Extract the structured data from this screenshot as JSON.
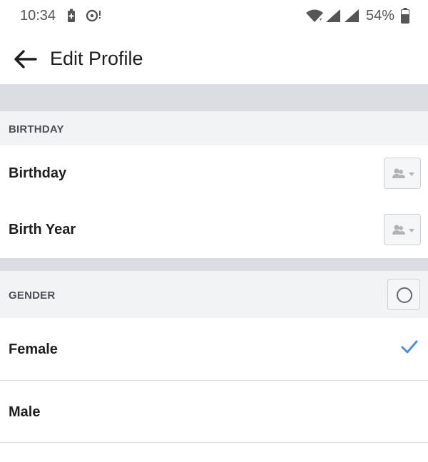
{
  "status_bar": {
    "time": "10:34",
    "battery_percent": "54%"
  },
  "app_bar": {
    "title": "Edit Profile"
  },
  "birthday_section": {
    "header": "BIRTHDAY",
    "rows": [
      {
        "label": "Birthday",
        "value": "",
        "privacy_icon": "friends-icon"
      },
      {
        "label": "Birth Year",
        "value": "",
        "privacy_icon": "friends-icon"
      }
    ]
  },
  "gender_section": {
    "header": "GENDER",
    "options": [
      {
        "label": "Female",
        "selected": true
      },
      {
        "label": "Male",
        "selected": false
      }
    ]
  },
  "colors": {
    "accent": "#4a90e2",
    "section_bg": "#f2f3f5",
    "separator": "#dadde1"
  }
}
